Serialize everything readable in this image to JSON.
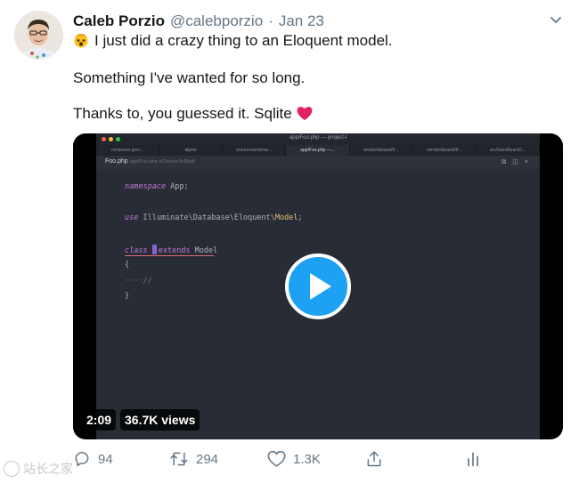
{
  "tweet": {
    "author_name": "Caleb Porzio",
    "handle": "@calebporzio",
    "separator": "·",
    "date": "Jan 23",
    "text_line1": "I just did a crazy thing to an Eloquent model.",
    "text_line2": "Something I've wanted for so long.",
    "text_line3": "Thanks to, you guessed it. Sqlite",
    "emoji_icons": [
      "exploding-head-emoji",
      "red-heart-emoji"
    ]
  },
  "video": {
    "duration": "2:09",
    "views": "36.7K views",
    "editor": {
      "window_title": "app/Foo.php — project-l",
      "tabs": [
        "composer.json...",
        "alpine",
        "resources/views...",
        "app/Foo.php —...",
        "vendor/laravel/fr...",
        "vendor/laravel/fr...",
        "src/UsesBearsD..."
      ],
      "active_tab_index": 3,
      "file_name": "Foo.php",
      "breadcrumb": "app/Foo.php  #Class#c3c8ba8",
      "code": {
        "l1_kw": "namespace",
        "l1_rest": " App;",
        "l2_kw": "use",
        "l2_rest": " Illuminate\\Database\\Eloquent\\",
        "l2_class": "Model",
        "l2_end": ";",
        "l3_kw": "class",
        "l3_kw2": "extends",
        "l3_rest": " Model",
        "l4": "{",
        "l5": "//",
        "l6": "}"
      }
    }
  },
  "actions": {
    "replies": "94",
    "retweets": "294",
    "likes": "1.3K",
    "icons": [
      "reply-icon",
      "retweet-icon",
      "like-icon",
      "share-icon",
      "analytics-icon"
    ]
  },
  "watermark": "站长之家",
  "colors": {
    "text": "#14171a",
    "secondary": "#657786",
    "accent": "#1da1f2",
    "heart": "#e0245e",
    "editor_bg": "#282c34"
  }
}
